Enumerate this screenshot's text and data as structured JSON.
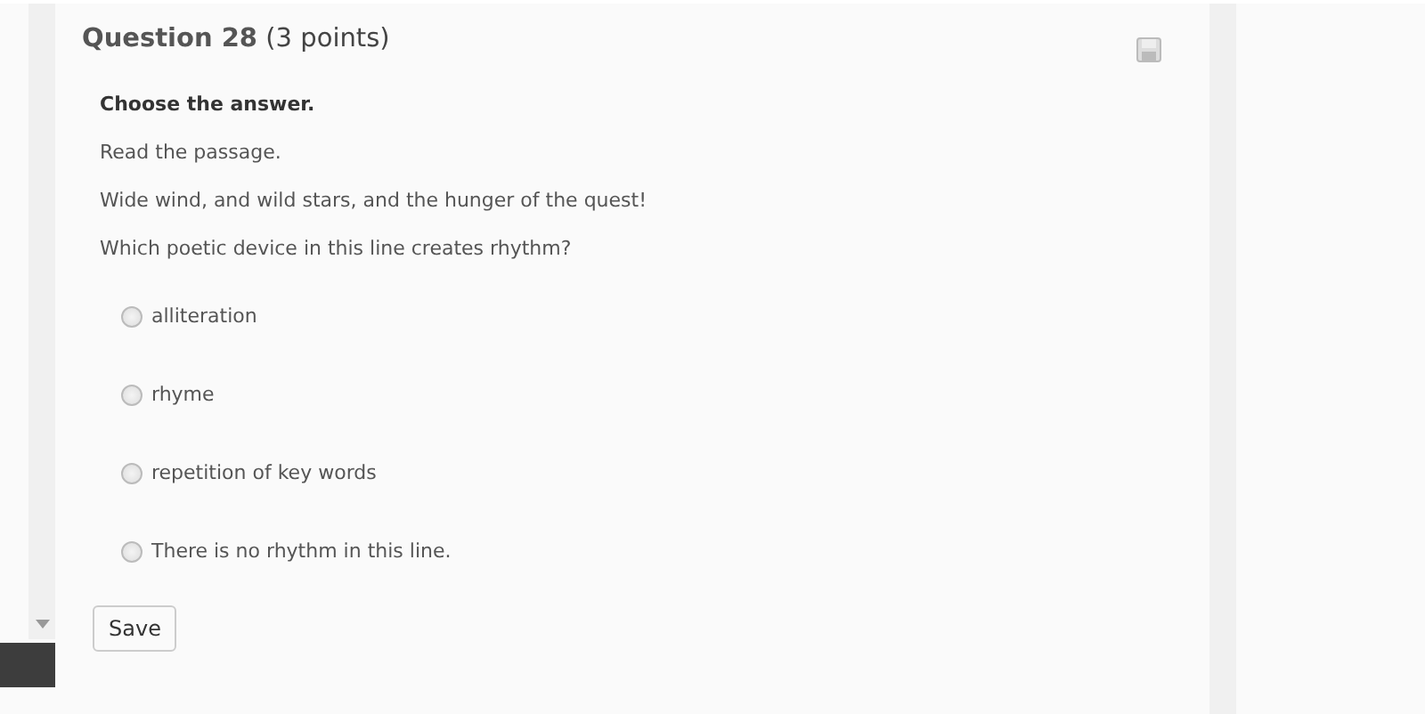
{
  "question": {
    "title": "**Question 28** (3 points)",
    "instruction": "Choose the answer.",
    "lines": [
      "Read the passage.",
      "Wide wind, and wild stars, and the hunger of the quest!",
      "Which poetic device in this line creates rhythm?"
    ],
    "options": [
      {
        "label": "alliteration",
        "selected": false
      },
      {
        "label": "rhyme",
        "selected": false
      },
      {
        "label": "repetition of key words",
        "selected": false
      },
      {
        "label": "There is no rhythm in this line.",
        "selected": false
      }
    ],
    "save_button": "Save"
  }
}
